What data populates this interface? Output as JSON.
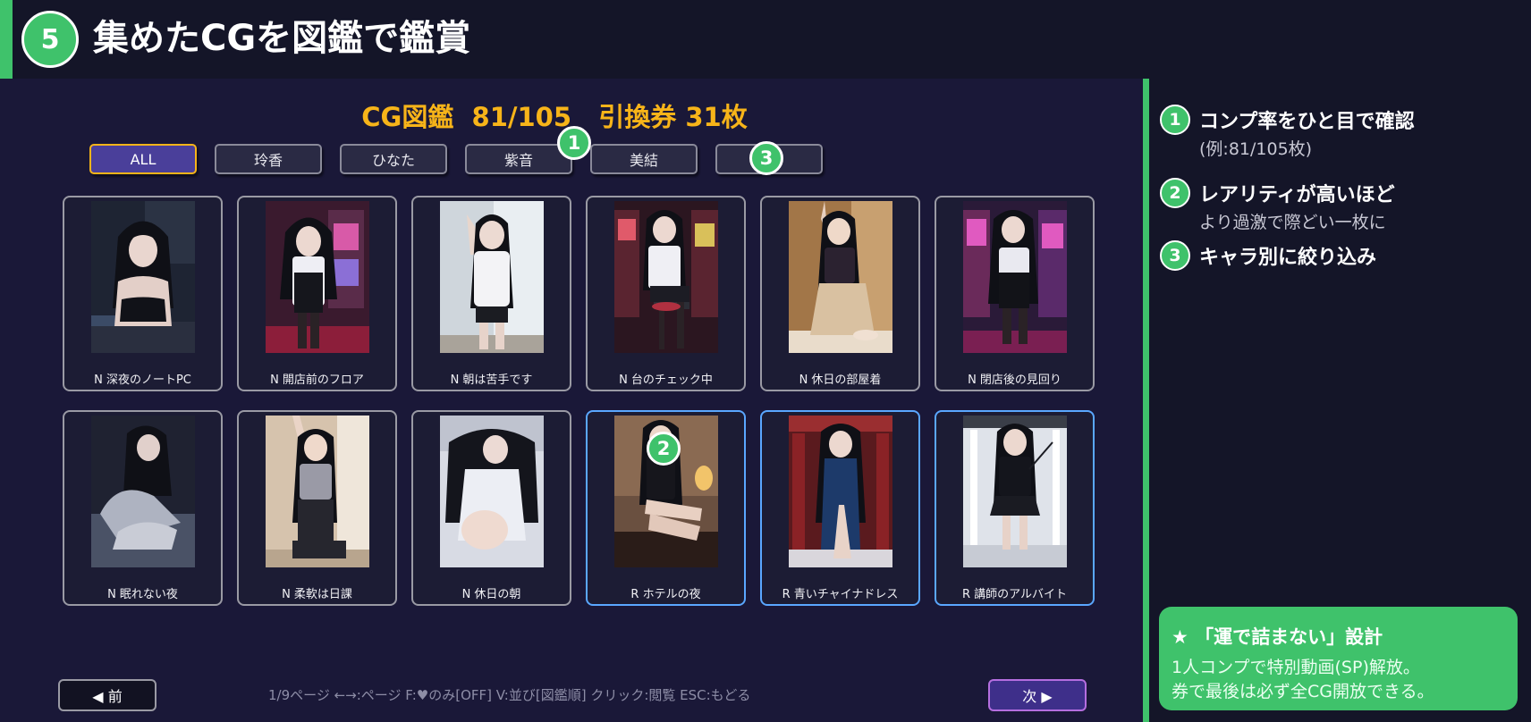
{
  "header": {
    "step_number": "5",
    "title": "集めたCGを図鑑で鑑賞"
  },
  "gallery": {
    "status_line": "CG図鑑  81/105   引換券 31枚",
    "filters": [
      {
        "label": "ALL",
        "active": true
      },
      {
        "label": "玲香",
        "active": false
      },
      {
        "label": "ひなた",
        "active": false
      },
      {
        "label": "紫音",
        "active": false
      },
      {
        "label": "美結",
        "active": false
      },
      {
        "label": "",
        "active": false
      }
    ],
    "cards": [
      {
        "label": "N 深夜のノートPC",
        "rarity": "N",
        "scene": "night-laptop"
      },
      {
        "label": "N 開店前のフロア",
        "rarity": "N",
        "scene": "casino-floor"
      },
      {
        "label": "N 朝は苦手です",
        "rarity": "N",
        "scene": "morning-window"
      },
      {
        "label": "N 台のチェック中",
        "rarity": "N",
        "scene": "casino-stool"
      },
      {
        "label": "N 休日の部屋着",
        "rarity": "N",
        "scene": "warm-room"
      },
      {
        "label": "N 閉店後の見回り",
        "rarity": "N",
        "scene": "casino-pink"
      },
      {
        "label": "N 眠れない夜",
        "rarity": "N",
        "scene": "dark-bed"
      },
      {
        "label": "N 柔軟は日課",
        "rarity": "N",
        "scene": "stretch-room"
      },
      {
        "label": "N 休日の朝",
        "rarity": "N",
        "scene": "white-bed"
      },
      {
        "label": "R ホテルの夜",
        "rarity": "R",
        "scene": "hotel-night"
      },
      {
        "label": "R 青いチャイナドレス",
        "rarity": "R",
        "scene": "red-hall"
      },
      {
        "label": "R 講師のアルバイト",
        "rarity": "R",
        "scene": "white-studio"
      }
    ],
    "prev_label": "◀ 前",
    "next_label": "次 ▶",
    "help_text": "1/9ページ  ←→:ページ  F:♥のみ[OFF]  V:並び[図鑑順]  クリック:閲覧  ESC:もどる"
  },
  "callouts": [
    "1",
    "2",
    "3"
  ],
  "sidebar": {
    "points": [
      {
        "num": "1",
        "title": "コンプ率をひと目で確認",
        "sub": "(例:81/105枚)"
      },
      {
        "num": "2",
        "title": "レアリティが高いほど",
        "sub": "より過激で際どい一枚に"
      },
      {
        "num": "3",
        "title": "キャラ別に絞り込み",
        "sub": ""
      }
    ],
    "promo": {
      "title": "★ 「運で詰まない」設計",
      "line1": "1人コンプで特別動画(SP)解放。",
      "line2": "券で最後は必ず全CG開放できる。"
    }
  },
  "colors": {
    "accent_green": "#3fc26b",
    "gold": "#f7b419",
    "rare_border": "#5aa7ff",
    "active_tab": "#4a3f9a",
    "next_button": "#3e2f8a"
  }
}
